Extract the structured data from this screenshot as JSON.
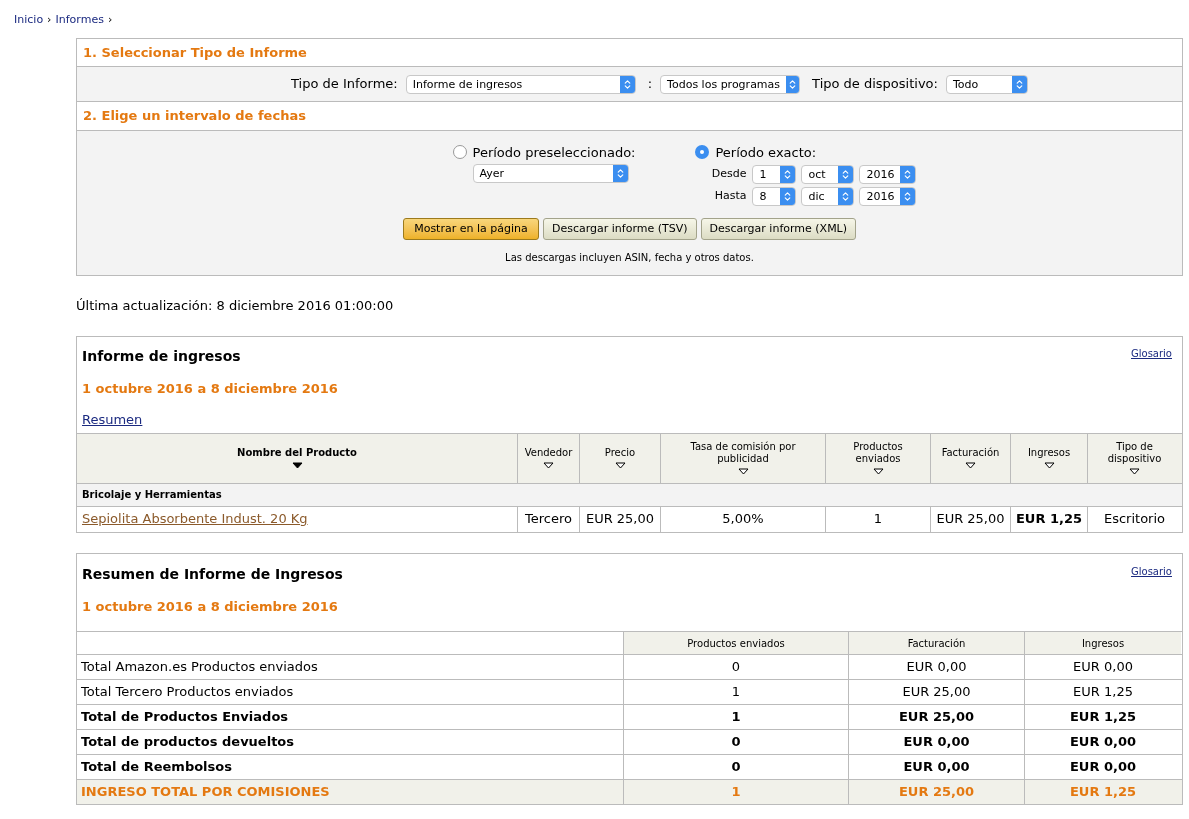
{
  "breadcrumb": [
    {
      "label": "Inicio",
      "sep": "›"
    },
    {
      "label": "Informes",
      "sep": "›"
    }
  ],
  "step1": {
    "title": "1. Seleccionar Tipo de Informe",
    "fields": [
      {
        "label": "Tipo de Informe:",
        "value": "Informe de ingresos"
      },
      {
        "label": ":",
        "value": "Todos los programas"
      },
      {
        "label": "Tipo de dispositivo:",
        "value": "Todo"
      }
    ]
  },
  "step2": {
    "title": "2. Elige un intervalo de fechas",
    "preset": {
      "label": "Período preseleccionado:",
      "selected": false,
      "value": "Ayer"
    },
    "exact": {
      "label": "Período exacto:",
      "selected": true,
      "rows": [
        {
          "label": "Desde",
          "day": "1",
          "month": "oct",
          "year": "2016"
        },
        {
          "label": "Hasta",
          "day": "8",
          "month": "dic",
          "year": "2016"
        }
      ]
    },
    "buttons": [
      {
        "label": "Mostrar en la página",
        "primary": true
      },
      {
        "label": "Descargar informe (TSV)",
        "primary": false
      },
      {
        "label": "Descargar informe (XML)",
        "primary": false
      }
    ],
    "note": "Las descargas incluyen ASIN, fecha y otros datos."
  },
  "last_update": "Última actualización: 8 diciembre 2016 01:00:00",
  "report": {
    "title": "Informe de ingresos",
    "glossary": "Glosario",
    "range": "1 octubre 2016 a 8 diciembre 2016",
    "summary_link": "Resumen",
    "columns": [
      {
        "label": "Nombre del Producto",
        "sorted": true
      },
      {
        "label": "Vendedor",
        "sorted": false
      },
      {
        "label": "Precio",
        "sorted": false
      },
      {
        "label": "Tasa de comisión por publicidad",
        "sorted": false
      },
      {
        "label": "Productos enviados",
        "sorted": false
      },
      {
        "label": "Facturación",
        "sorted": false
      },
      {
        "label": "Ingresos",
        "sorted": false
      },
      {
        "label": "Tipo de dispositivo",
        "sorted": false
      }
    ],
    "category": "Bricolaje y Herramientas",
    "rows": [
      [
        "Sepiolita Absorbente Indust. 20 Kg",
        "Tercero",
        "EUR 25,00",
        "5,00%",
        "1",
        "EUR 25,00",
        "EUR 1,25",
        "Escritorio"
      ]
    ]
  },
  "summary": {
    "title": "Resumen de Informe de Ingresos",
    "glossary": "Glosario",
    "range": "1 octubre 2016 a 8 diciembre 2016",
    "columns": [
      "",
      "Productos enviados",
      "Facturación",
      "Ingresos"
    ],
    "rows": [
      {
        "kind": "normal",
        "cells": [
          "Total Amazon.es Productos enviados",
          "0",
          "EUR 0,00",
          "EUR 0,00"
        ]
      },
      {
        "kind": "normal",
        "cells": [
          "Total Tercero Productos enviados",
          "1",
          "EUR 25,00",
          "EUR 1,25"
        ]
      },
      {
        "kind": "bold",
        "cells": [
          "Total de Productos Enviados",
          "1",
          "EUR 25,00",
          "EUR 1,25"
        ]
      },
      {
        "kind": "bold",
        "cells": [
          "Total de productos devueltos",
          "0",
          "EUR 0,00",
          "EUR 0,00"
        ]
      },
      {
        "kind": "bold",
        "cells": [
          "Total de Reembolsos",
          "0",
          "EUR 0,00",
          "EUR 0,00"
        ]
      },
      {
        "kind": "total",
        "cells": [
          "INGRESO TOTAL POR COMISIONES",
          "1",
          "EUR 25,00",
          "EUR 1,25"
        ]
      }
    ]
  }
}
